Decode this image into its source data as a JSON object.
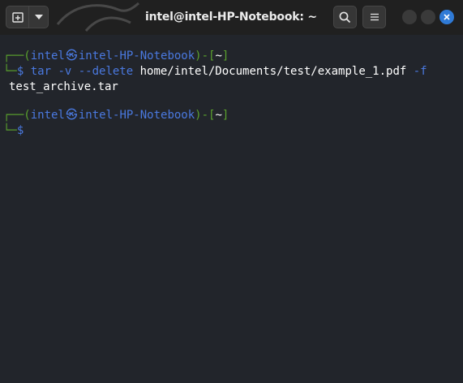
{
  "window": {
    "title": "intel@intel-HP-Notebook: ~"
  },
  "icons": {
    "new_tab": "new-tab-icon",
    "dropdown": "chevron-down-icon",
    "search": "search-icon",
    "menu": "hamburger-menu-icon",
    "minimize": "minimize-icon",
    "maximize": "maximize-icon",
    "close": "close-icon",
    "kali_skull": "kali-skull-icon"
  },
  "colors": {
    "background": "#22252b",
    "titlebar": "#202020",
    "prompt_frame": "#5aa22c",
    "prompt_user": "#4a79e0",
    "close_button": "#2f7ad6"
  },
  "terminal": {
    "block1": {
      "frame_top": "┌──(",
      "user": "intel",
      "skull": "㉿",
      "host": "intel-HP-Notebook",
      "frame_mid": ")-[",
      "cwd": "~",
      "frame_end": "]",
      "frame_bottom": "└─",
      "prompt": "$ ",
      "cmd": "tar",
      "arg1": " -v --delete ",
      "path": "home/intel/Documents/test/example_1.pdf",
      "arg2": " -f",
      "continuation": "test_archive.tar"
    },
    "block2": {
      "frame_top": "┌──(",
      "user": "intel",
      "skull": "㉿",
      "host": "intel-HP-Notebook",
      "frame_mid": ")-[",
      "cwd": "~",
      "frame_end": "]",
      "frame_bottom": "└─",
      "prompt": "$"
    }
  }
}
